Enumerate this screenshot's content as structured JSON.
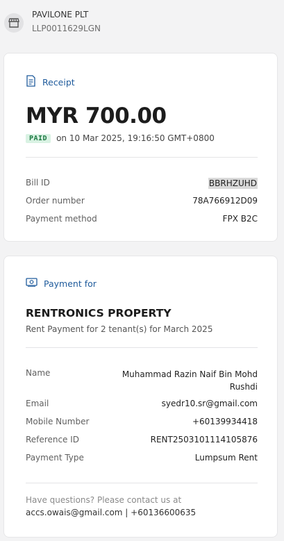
{
  "merchant": {
    "name": "PAVILONE PLT",
    "id": "LLP0011629LGN",
    "icon": "store-icon"
  },
  "receipt": {
    "section_label": "Receipt",
    "icon": "receipt-icon",
    "amount": "MYR 700.00",
    "status_badge": "PAID",
    "paid_on": "on 10 Mar 2025, 19:16:50 GMT+0800",
    "details": [
      {
        "label": "Bill ID",
        "value": "BBRHZUHD"
      },
      {
        "label": "Order number",
        "value": "78A766912D09"
      },
      {
        "label": "Payment method",
        "value": "FPX B2C"
      }
    ]
  },
  "payment_for": {
    "section_label": "Payment for",
    "icon": "cash-icon",
    "title": "RENTRONICS PROPERTY",
    "description": "Rent Payment for 2 tenant(s) for March 2025",
    "details": [
      {
        "label": "Name",
        "value_line1": "Muhammad Razin Naif Bin Mohd",
        "value_line2": "Rushdi"
      },
      {
        "label": "Email",
        "value": "syedr10.sr@gmail.com"
      },
      {
        "label": "Mobile Number",
        "value": "+60139934418"
      },
      {
        "label": "Reference ID",
        "value": "RENT2503101114105876"
      },
      {
        "label": "Payment Type",
        "value": "Lumpsum Rent"
      }
    ],
    "footer_question": "Have questions? Please contact us at",
    "footer_contact": "accs.owais@gmail.com | +60136600635"
  },
  "colors": {
    "accent": "#1f5b9c",
    "paid_bg": "#d9f2e3",
    "paid_text": "#1d7a43",
    "page_bg": "#f3f3f4"
  }
}
